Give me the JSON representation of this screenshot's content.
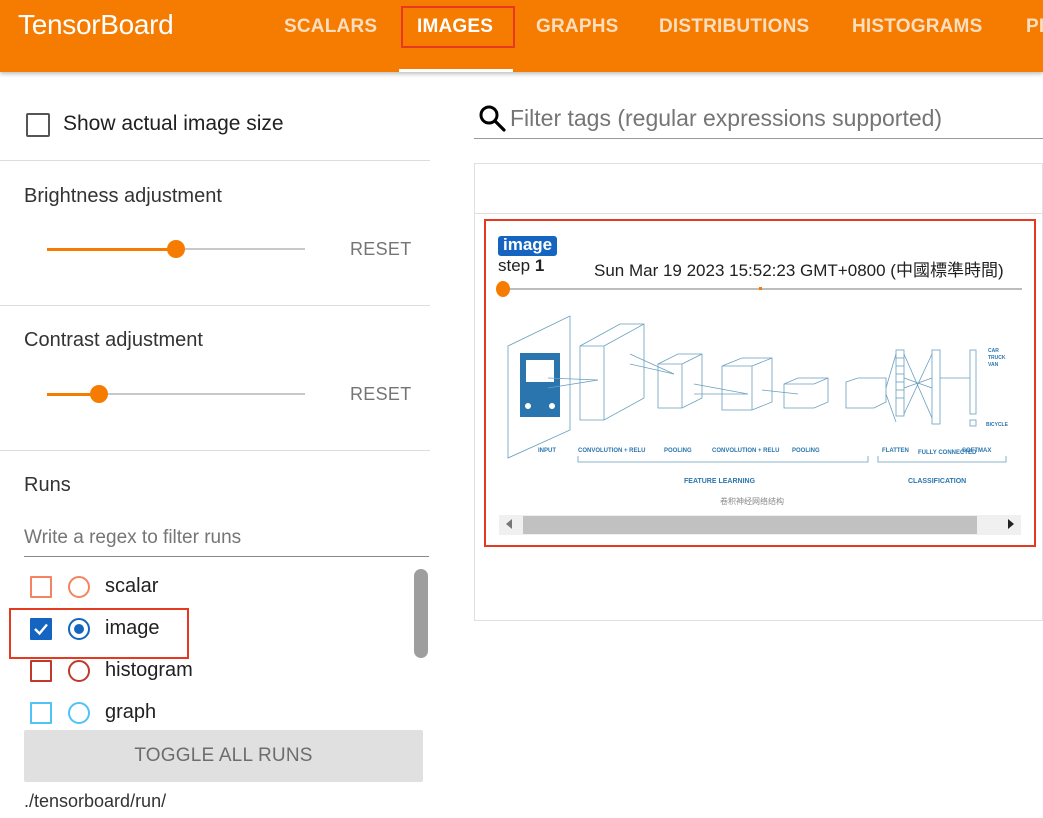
{
  "app": {
    "title": "TensorBoard"
  },
  "tabs": [
    {
      "label": "SCALARS"
    },
    {
      "label": "IMAGES"
    },
    {
      "label": "GRAPHS"
    },
    {
      "label": "DISTRIBUTIONS"
    },
    {
      "label": "HISTOGRAMS"
    },
    {
      "label": "PI"
    }
  ],
  "active_tab": "IMAGES",
  "colors": {
    "accent": "#f57c00",
    "highlight": "#e53a1f",
    "tag_chip": "#1565c0"
  },
  "sidebar": {
    "show_actual_size_label": "Show actual image size",
    "brightness": {
      "title": "Brightness adjustment",
      "reset_label": "RESET",
      "level": 0.5
    },
    "contrast": {
      "title": "Contrast adjustment",
      "reset_label": "RESET",
      "level": 0.2
    },
    "runs": {
      "title": "Runs",
      "filter_placeholder": "Write a regex to filter runs",
      "items": [
        {
          "name": "scalar",
          "checked": false,
          "color": "#f4845f",
          "radio_selected": false
        },
        {
          "name": "image",
          "checked": true,
          "color": "#1565c0",
          "radio_selected": true
        },
        {
          "name": "histogram",
          "checked": false,
          "color": "#c0392b",
          "radio_selected": false
        },
        {
          "name": "graph",
          "checked": false,
          "color": "#4fc3f7",
          "radio_selected": false
        }
      ],
      "toggle_all_label": "TOGGLE ALL RUNS",
      "logdir": "./tensorboard/run/"
    }
  },
  "main": {
    "filter_placeholder": "Filter tags (regular expressions supported)",
    "image_card": {
      "tag": "image",
      "step_prefix": "step",
      "step": "1",
      "wall_time": "Sun Mar 19 2023 15:52:23 GMT+0800 (中國標準時間)",
      "image_labels": {
        "input": "INPUT",
        "conv1": "CONVOLUTION + RELU",
        "pool1": "POOLING",
        "conv2": "CONVOLUTION + RELU",
        "pool2": "POOLING",
        "flatten": "FLATTEN",
        "fc": "FULLY CONNECTED",
        "softmax": "SOFTMAX",
        "feature_learning": "FEATURE LEARNING",
        "classification": "CLASSIFICATION",
        "class_car": "CAR",
        "class_truck": "TRUCK",
        "class_van": "VAN",
        "class_bicycle": "BICYCLE",
        "caption": "卷积神经网络结构"
      }
    }
  }
}
